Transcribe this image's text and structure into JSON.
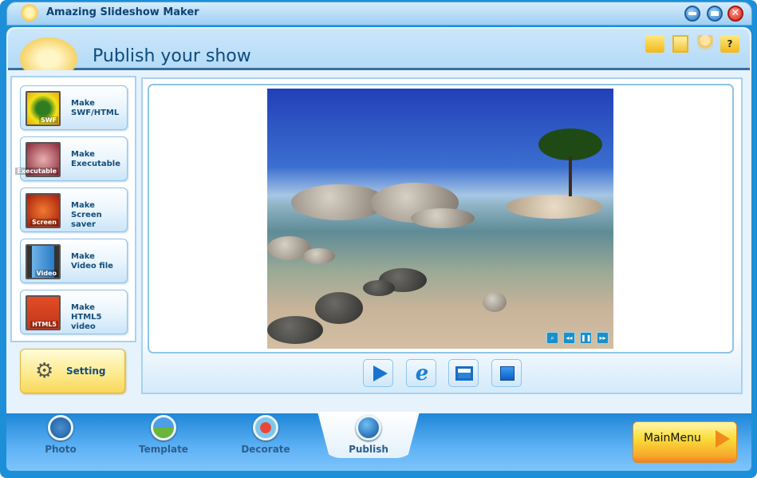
{
  "app": {
    "title": "Amazing Slideshow Maker"
  },
  "header": {
    "title": "Publish your show",
    "icons": [
      "folder-icon",
      "save-icon",
      "user-icon",
      "help-icon"
    ]
  },
  "window_controls": [
    "minimize",
    "maximize",
    "close"
  ],
  "publish_options": [
    {
      "line1": "Make",
      "line2": "SWF/HTML",
      "badge": "SWF"
    },
    {
      "line1": "Make",
      "line2": "Executable",
      "badge": "Executable"
    },
    {
      "line1": "Make",
      "line2": "Screen saver",
      "badge": "Screen"
    },
    {
      "line1": "Make",
      "line2": "Video file",
      "badge": "Video"
    },
    {
      "line1": "Make",
      "line2": "HTML5 video",
      "badge": "HTML5"
    }
  ],
  "setting": {
    "label": "Setting"
  },
  "player_overlay": [
    "zoom",
    "previous",
    "pause",
    "next"
  ],
  "controls": [
    "play",
    "internet-explorer",
    "fullscreen",
    "stop"
  ],
  "tabs": [
    {
      "label": "Photo"
    },
    {
      "label": "Template"
    },
    {
      "label": "Decorate"
    },
    {
      "label": "Publish",
      "active": true
    }
  ],
  "main_menu": {
    "label": "MainMenu"
  }
}
